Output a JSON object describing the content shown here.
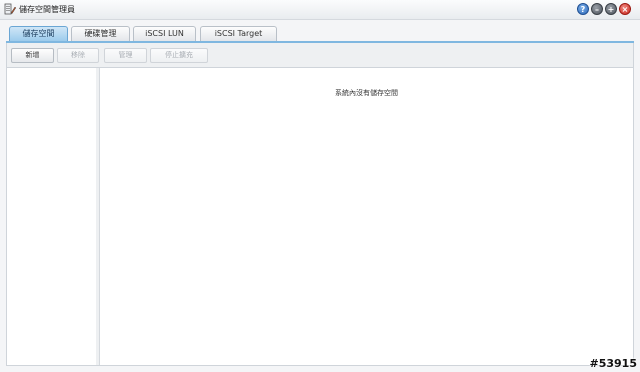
{
  "window": {
    "title": "儲存空間管理員",
    "controls": {
      "help_icon": "help-icon",
      "minimize_icon": "minimize-icon",
      "maximize_icon": "maximize-icon",
      "close_icon": "close-icon",
      "help_label": "?",
      "minimize_label": "–",
      "maximize_label": "+",
      "close_label": "×"
    }
  },
  "tabs": [
    {
      "label": "儲存空間",
      "active": true
    },
    {
      "label": "硬碟管理",
      "active": false
    },
    {
      "label": "iSCSI LUN",
      "active": false
    },
    {
      "label": "iSCSI Target",
      "active": false
    }
  ],
  "toolbar": {
    "create_label": "新增",
    "remove_label": "移除",
    "manage_label": "管理",
    "stop_label": "停止擴充"
  },
  "main": {
    "empty_message": "系統內沒有儲存空間"
  },
  "watermark": "#53915",
  "colors": {
    "active_tab": "#9ccbec",
    "tab_rule": "#7fb7e0",
    "close": "#c9261d",
    "help": "#2c67b8"
  }
}
